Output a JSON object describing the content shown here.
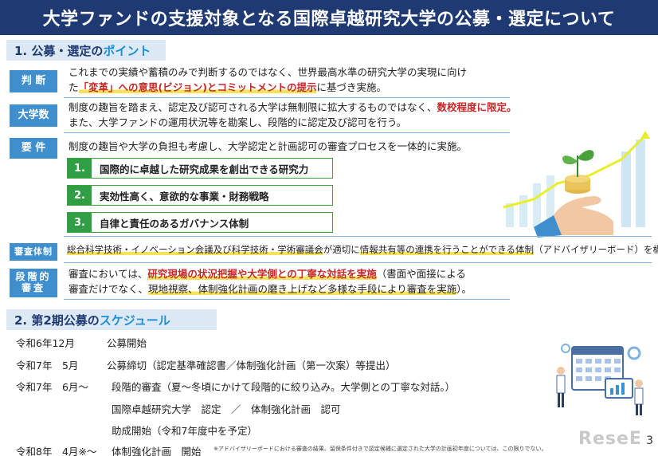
{
  "title": "大学ファンドの支援対象となる国際卓越研究大学の公募・選定について",
  "section1": {
    "prefix": "1. 公募・選定の",
    "accent": "ポイント"
  },
  "judgment": {
    "label": "判 断",
    "line1": "これまでの実績や蓄積のみで判断するのではなく、世界最高水準の研究大学の実現に向け",
    "line2_a": "た",
    "line2_b": "「変革」への意思(ビジョン)とコミットメントの提示",
    "line2_c": "に基づき実施。"
  },
  "count": {
    "label": "大学数",
    "line1_a": "制度の趣旨を踏まえ、認定及び認可される大学は無制限に拡大するものではなく、",
    "line1_b": "数校程度に限定。",
    "line2": "また、大学ファンドの運用状況等を勘案し、段階的に認定及び認可を行う。"
  },
  "requirements": {
    "label": "要 件",
    "line1": "制度の趣旨や大学の負担も考慮し、大学認定と計画認可の審査プロセスを一体的に実施。",
    "items": [
      {
        "num": "1.",
        "text": "国際的に卓越した研究成果を創出できる研究力"
      },
      {
        "num": "2.",
        "text": "実効性高く、意欲的な事業・財務戦略"
      },
      {
        "num": "3.",
        "text": "自律と責任のあるガバナンス体制"
      }
    ]
  },
  "review_system": {
    "label": "審査体制",
    "text_a": "総合科学技術・イノベーション会議及び科学技術・学術審議会",
    "text_b": "が適切に",
    "text_c": "情報共有等の連携を行うことができる体制",
    "text_d": "（アドバイザリーボード）を構築。"
  },
  "staged": {
    "label": "段階的審査",
    "line1_a": "審査においては、",
    "line1_b": "研究現場の状況把握や大学側との丁寧な対話を実施",
    "line1_c": "（書面や面接による",
    "line2_a": "審査だけでなく、",
    "line2_b": "現地視察、体制強化計画の磨き上げなど多様な手段により審査を実施",
    "line2_c": "）。"
  },
  "section2": {
    "prefix": "2. 第2期公募の",
    "accent": "スケジュール"
  },
  "schedule": [
    {
      "date": "令和6年12月",
      "text": "公募開始"
    },
    {
      "date": "令和7年　5月",
      "text": "公募締切（認定基準確認書／体制強化計画（第一次案）等提出）"
    },
    {
      "date": "令和7年　6月～",
      "text": "段階的審査（夏～冬頃にかけて段階的に絞り込み。大学側との丁寧な対話。）"
    },
    {
      "date": "",
      "text": "国際卓越研究大学　認定　／　体制強化計画　認可"
    },
    {
      "date": "",
      "text": "助成開始（令和7年度中を予定）"
    },
    {
      "date": "令和8年　4月※～",
      "text": "体制強化計画　開始"
    }
  ],
  "footnote": "※アドバイザリーボードにおける審査の結果、留保条件付きで認定候補に選定された大学の計画初年度については、この限りでない。",
  "page_number": "3",
  "logo_text": "ReseE",
  "colors": {
    "title_bg": "#1f3a73",
    "label_bg": "#3f8fcf",
    "pill_green": "#2f9e44",
    "accent_red": "#c62828",
    "highlight": "#f7e35a"
  }
}
